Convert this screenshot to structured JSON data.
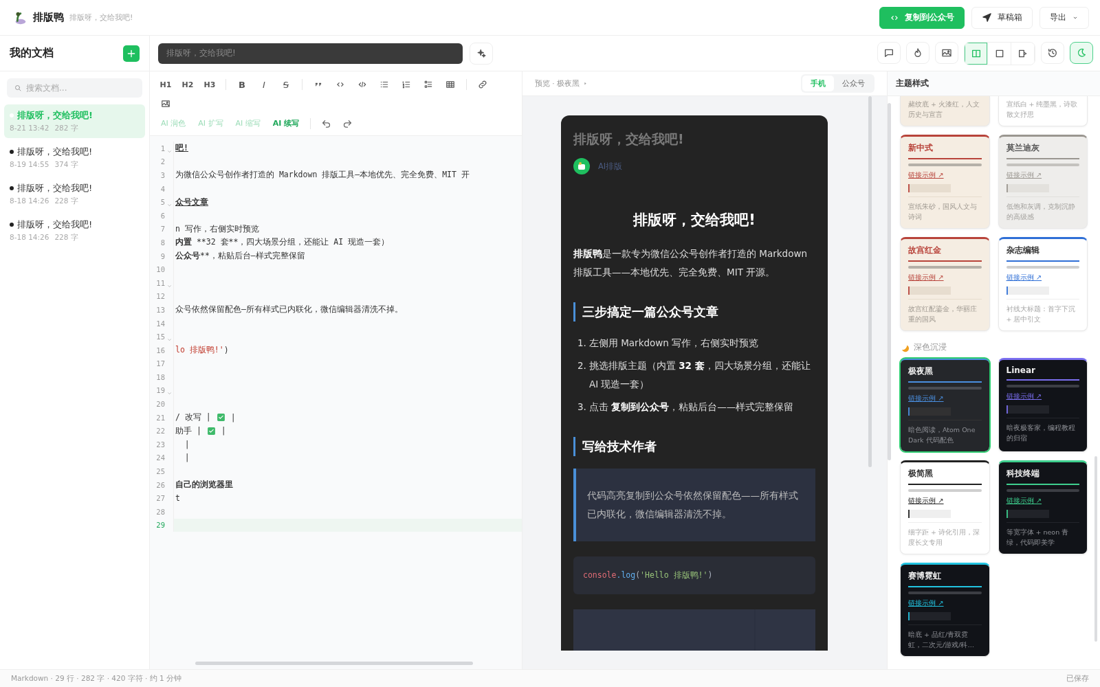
{
  "app": {
    "name": "排版鸭",
    "tagline": "排版呀，交给我吧!"
  },
  "actions": [
    {
      "kind": "copy",
      "label": "复制到公众号"
    },
    {
      "kind": "drafts",
      "label": "草稿箱"
    },
    {
      "kind": "export",
      "label": "导出"
    }
  ],
  "sidebar": {
    "title": "我的文档",
    "search": {
      "placeholder": "搜索文档..."
    },
    "docs": [
      {
        "title": "排版呀，交给我吧!",
        "date": "8-21 13:42",
        "count": "282 字",
        "selected": true
      },
      {
        "title": "排版呀，交给我吧!",
        "date": "8-19 14:55",
        "count": "374 字",
        "selected": false
      },
      {
        "title": "排版呀，交给我吧!",
        "date": "8-18 14:26",
        "count": "228 字",
        "selected": false
      },
      {
        "title": "排版呀，交给我吧!",
        "date": "8-18 14:26",
        "count": "228 字",
        "selected": false
      }
    ]
  },
  "doc_title": {
    "value": "排版呀，交给我吧!"
  },
  "tools_left": [
    {
      "kind": "comment",
      "on": false
    },
    {
      "kind": "fire",
      "on": false
    },
    {
      "kind": "image",
      "on": false
    }
  ],
  "view_modes": [
    {
      "kind": "split",
      "selected": true
    },
    {
      "kind": "editor",
      "selected": false
    },
    {
      "kind": "preview",
      "selected": false
    }
  ],
  "tools_right": [
    {
      "kind": "history",
      "on": false
    },
    {
      "kind": "moon",
      "on": true
    }
  ],
  "format_tools": [
    {
      "kind": "text",
      "label": "H1"
    },
    {
      "kind": "text",
      "label": "H2"
    },
    {
      "kind": "text",
      "label": "H3"
    },
    {
      "kind": "sep"
    },
    {
      "kind": "bold",
      "label": "B"
    },
    {
      "kind": "italic",
      "label": "I"
    },
    {
      "kind": "strike",
      "label": "S"
    },
    {
      "kind": "sep"
    },
    {
      "kind": "quote"
    },
    {
      "kind": "code"
    },
    {
      "kind": "codeblock"
    },
    {
      "kind": "ul"
    },
    {
      "kind": "ol"
    },
    {
      "kind": "task"
    },
    {
      "kind": "table"
    },
    {
      "kind": "sep"
    },
    {
      "kind": "link"
    },
    {
      "kind": "image"
    }
  ],
  "ai_tools": [
    {
      "label": "AI 润色",
      "highlighted": false
    },
    {
      "label": "AI 扩写",
      "highlighted": false
    },
    {
      "label": "AI 缩写",
      "highlighted": false
    },
    {
      "label": "AI 续写",
      "highlighted": true
    }
  ],
  "history_tools": [
    {
      "kind": "undo"
    },
    {
      "kind": "redo"
    }
  ],
  "editor": {
    "lines": [
      {
        "number": "1",
        "fold": true,
        "active": false,
        "parts": [
          {
            "kind": "heading",
            "text": "吧!"
          }
        ]
      },
      {
        "number": "2",
        "fold": false,
        "active": false
      },
      {
        "number": "3",
        "fold": false,
        "active": false,
        "parts": [
          {
            "kind": "text",
            "text": "为微信公众号创作者打造的 Markdown 排版工具—本地优先、完全免费、MIT 开"
          }
        ]
      },
      {
        "number": "4",
        "fold": false,
        "active": false
      },
      {
        "number": "5",
        "fold": true,
        "active": false,
        "parts": [
          {
            "kind": "heading",
            "text": "众号文章"
          }
        ]
      },
      {
        "number": "6",
        "fold": false,
        "active": false
      },
      {
        "number": "7",
        "fold": false,
        "active": false,
        "parts": [
          {
            "kind": "text",
            "text": "n 写作，右侧实时预览"
          }
        ]
      },
      {
        "number": "8",
        "fold": false,
        "active": false,
        "parts": [
          {
            "kind": "bold",
            "text": "内置"
          },
          {
            "kind": "text",
            "text": " **32 套**，四大场景分组，还能让 AI 现造一套）"
          }
        ]
      },
      {
        "number": "9",
        "fold": false,
        "active": false,
        "parts": [
          {
            "kind": "bold",
            "text": "公众号"
          },
          {
            "kind": "text",
            "text": "**，粘贴后台—样式完整保留"
          }
        ]
      },
      {
        "number": "10",
        "fold": false,
        "active": false
      },
      {
        "number": "11",
        "fold": true,
        "active": false
      },
      {
        "number": "12",
        "fold": false,
        "active": false
      },
      {
        "number": "13",
        "fold": false,
        "active": false,
        "parts": [
          {
            "kind": "text",
            "text": "众号依然保留配色—所有样式已内联化，微信编辑器清洗不掉。"
          }
        ]
      },
      {
        "number": "14",
        "fold": false,
        "active": false
      },
      {
        "number": "15",
        "fold": true,
        "active": false
      },
      {
        "number": "16",
        "fold": false,
        "active": false,
        "parts": [
          {
            "kind": "string",
            "text": "lo 排版鸭!'"
          },
          {
            "kind": "text",
            "text": ")"
          }
        ]
      },
      {
        "number": "17",
        "fold": false,
        "active": false
      },
      {
        "number": "18",
        "fold": false,
        "active": false
      },
      {
        "number": "19",
        "fold": true,
        "active": false
      },
      {
        "number": "20",
        "fold": false,
        "active": false
      },
      {
        "number": "21",
        "fold": false,
        "active": false,
        "parts": [
          {
            "kind": "text",
            "text": "/ 改写 |"
          },
          {
            "kind": "check"
          },
          {
            "kind": "text",
            "text": "|"
          }
        ]
      },
      {
        "number": "22",
        "fold": false,
        "active": false,
        "parts": [
          {
            "kind": "text",
            "text": "助手 |"
          },
          {
            "kind": "check"
          },
          {
            "kind": "text",
            "text": "|"
          }
        ]
      },
      {
        "number": "23",
        "fold": false,
        "active": false,
        "parts": [
          {
            "kind": "text",
            "text": "  |"
          }
        ]
      },
      {
        "number": "24",
        "fold": false,
        "active": false,
        "parts": [
          {
            "kind": "text",
            "text": "  |"
          }
        ]
      },
      {
        "number": "25",
        "fold": false,
        "active": false
      },
      {
        "number": "26",
        "fold": false,
        "active": false,
        "parts": [
          {
            "kind": "bold",
            "text": "自己的浏览器里"
          }
        ]
      },
      {
        "number": "27",
        "fold": false,
        "active": false,
        "parts": [
          {
            "kind": "text",
            "text": "t"
          }
        ]
      },
      {
        "number": "28",
        "fold": false,
        "active": false
      },
      {
        "number": "29",
        "fold": false,
        "active": true
      }
    ]
  },
  "preview": {
    "breadcrumb": "预览 · 极夜黑",
    "devices": [
      {
        "label": "手机",
        "selected": true
      },
      {
        "label": "公众号",
        "selected": false
      }
    ],
    "article": {
      "title": "排版呀，交给我吧!",
      "author": "AI排版",
      "blocks": [
        {
          "kind": "h1",
          "text": "排版呀，交给我吧!"
        },
        {
          "kind": "p",
          "text": "**排版鸭**是一款专为微信公众号创作者打造的 Markdown 排版工具——本地优先、完全免费、MIT 开源。"
        },
        {
          "kind": "h2",
          "text": "三步搞定一篇公众号文章"
        },
        {
          "kind": "ol",
          "items": [
            {
              "number": "1.",
              "text": "左侧用 Markdown 写作，右侧实时预览"
            },
            {
              "number": "2.",
              "text": "挑选排版主题（内置 **32 套**，四大场景分组，还能让 AI 现造一套）"
            },
            {
              "number": "3.",
              "text": "点击 **复制到公众号**，粘贴后台——样式完整保留"
            }
          ]
        },
        {
          "kind": "h2",
          "text": "写给技术作者"
        },
        {
          "kind": "quote",
          "text": "代码高亮复制到公众号依然保留配色——所有样式已内联化，微信编辑器清洗不掉。"
        },
        {
          "kind": "code",
          "tokens": [
            {
              "kind": "name",
              "text": "console"
            },
            {
              "kind": "fn",
              "text": ".log"
            },
            {
              "kind": "punct",
              "text": "("
            },
            {
              "kind": "string",
              "text": "'Hello 排版鸭!'"
            },
            {
              "kind": "punct",
              "text": ")"
            }
          ]
        },
        {
          "kind": "table"
        }
      ]
    }
  },
  "themes": {
    "title": "主题样式",
    "groups": [
      {
        "cards": [
          {
            "kind": "paper",
            "cut": true,
            "selected": false,
            "description": "赭纹底 + 火漆红，人文历史与宣言"
          },
          {
            "kind": "white",
            "cut": true,
            "selected": false,
            "description": "宣纸白 + 纯墨黑，诗歌散文抒思"
          },
          {
            "kind": "paper",
            "cut": false,
            "selected": false,
            "name": "新中式",
            "color": "#b8433a",
            "link": "链接示例 ↗",
            "description": "宣纸朱砂，国风人文与诗词"
          },
          {
            "kind": "gray",
            "cut": false,
            "selected": false,
            "name": "莫兰迪灰",
            "color": "#9a9690",
            "link": "链接示例 ↗",
            "description": "低饱和灰调，克制沉静的高级感"
          },
          {
            "kind": "paper",
            "cut": false,
            "selected": false,
            "name": "故宫红金",
            "color": "#b8433a",
            "link": "链接示例 ↗",
            "description": "故宫红配鎏金，华丽庄重的国风"
          },
          {
            "kind": "white",
            "cut": false,
            "selected": false,
            "name": "杂志编辑",
            "color": "#2f6fd6",
            "link": "链接示例 ↗",
            "description": "衬线大标题：首字下沉 + 居中引文"
          }
        ]
      },
      {
        "label": "深色沉浸",
        "cards": [
          {
            "kind": "dark",
            "cut": false,
            "selected": true,
            "name": "极夜黑",
            "color": "#4a8fe0",
            "link": "链接示例 ↗",
            "description": "暗色阅读，Atom One Dark 代码配色"
          },
          {
            "kind": "black",
            "cut": false,
            "selected": false,
            "name": "Linear",
            "color": "#7b6ff0",
            "link": "链接示例 ↗",
            "description": "暗夜极客家，编程教程的归宿"
          },
          {
            "kind": "white",
            "cut": false,
            "selected": false,
            "name": "极简黑",
            "color": "#222222",
            "link": "链接示例 ↗",
            "description": "细字距 + 诗化引用，深度长文专用"
          },
          {
            "kind": "black",
            "cut": false,
            "selected": false,
            "name": "科技终端",
            "color": "#3ecf8e",
            "link": "链接示例 ↗",
            "description": "等宽字体 + neon 青绿，代码即美学"
          },
          {
            "kind": "black",
            "cut": false,
            "selected": false,
            "name": "赛博霓虹",
            "color": "#22c3e0",
            "link": "链接示例 ↗",
            "description": "暗底 + 品红/青双霓虹，二次元/游戏/科…"
          }
        ]
      }
    ]
  },
  "status": {
    "left": "Markdown · 29 行 · 282 字 · 420 字符 · 约 1 分钟",
    "right": "已保存"
  }
}
